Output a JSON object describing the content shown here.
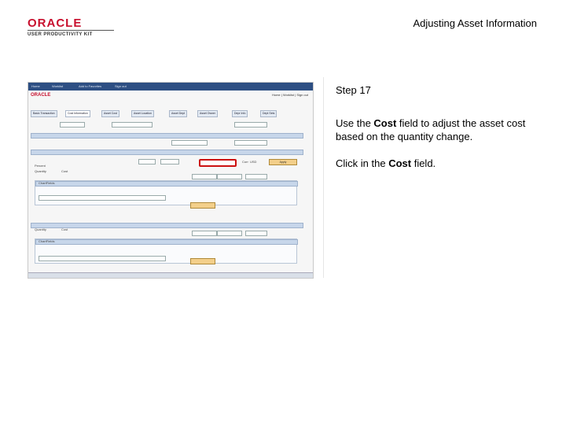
{
  "logo": {
    "brand": "ORACLE",
    "product": "USER PRODUCTIVITY KIT"
  },
  "title": "Adjusting Asset Information",
  "step": "Step 17",
  "instruction": {
    "before": "Use the ",
    "field": "Cost",
    "after": " field to adjust the asset cost based on the quantity change."
  },
  "action": {
    "before": "Click in the ",
    "field": "Cost",
    "after": " field."
  },
  "screenshot": {
    "top_links": [
      "Home",
      "Worklist",
      "Add to Favorites",
      "Sign out"
    ],
    "tabs": [
      "Basic Transaction",
      "Cost Information",
      "Asset Cost",
      "Asset Location",
      "Asset Dept",
      "Asset Owner",
      "Depr Info",
      "Dept Sets"
    ],
    "fields": {
      "quantity_label": "Quantity",
      "cost_label": "Cost",
      "percent_label": "Percent",
      "apply": "Apply",
      "currency_label": "Curr",
      "currency_value": "USD",
      "chartfields_label": "ChartFields"
    }
  }
}
